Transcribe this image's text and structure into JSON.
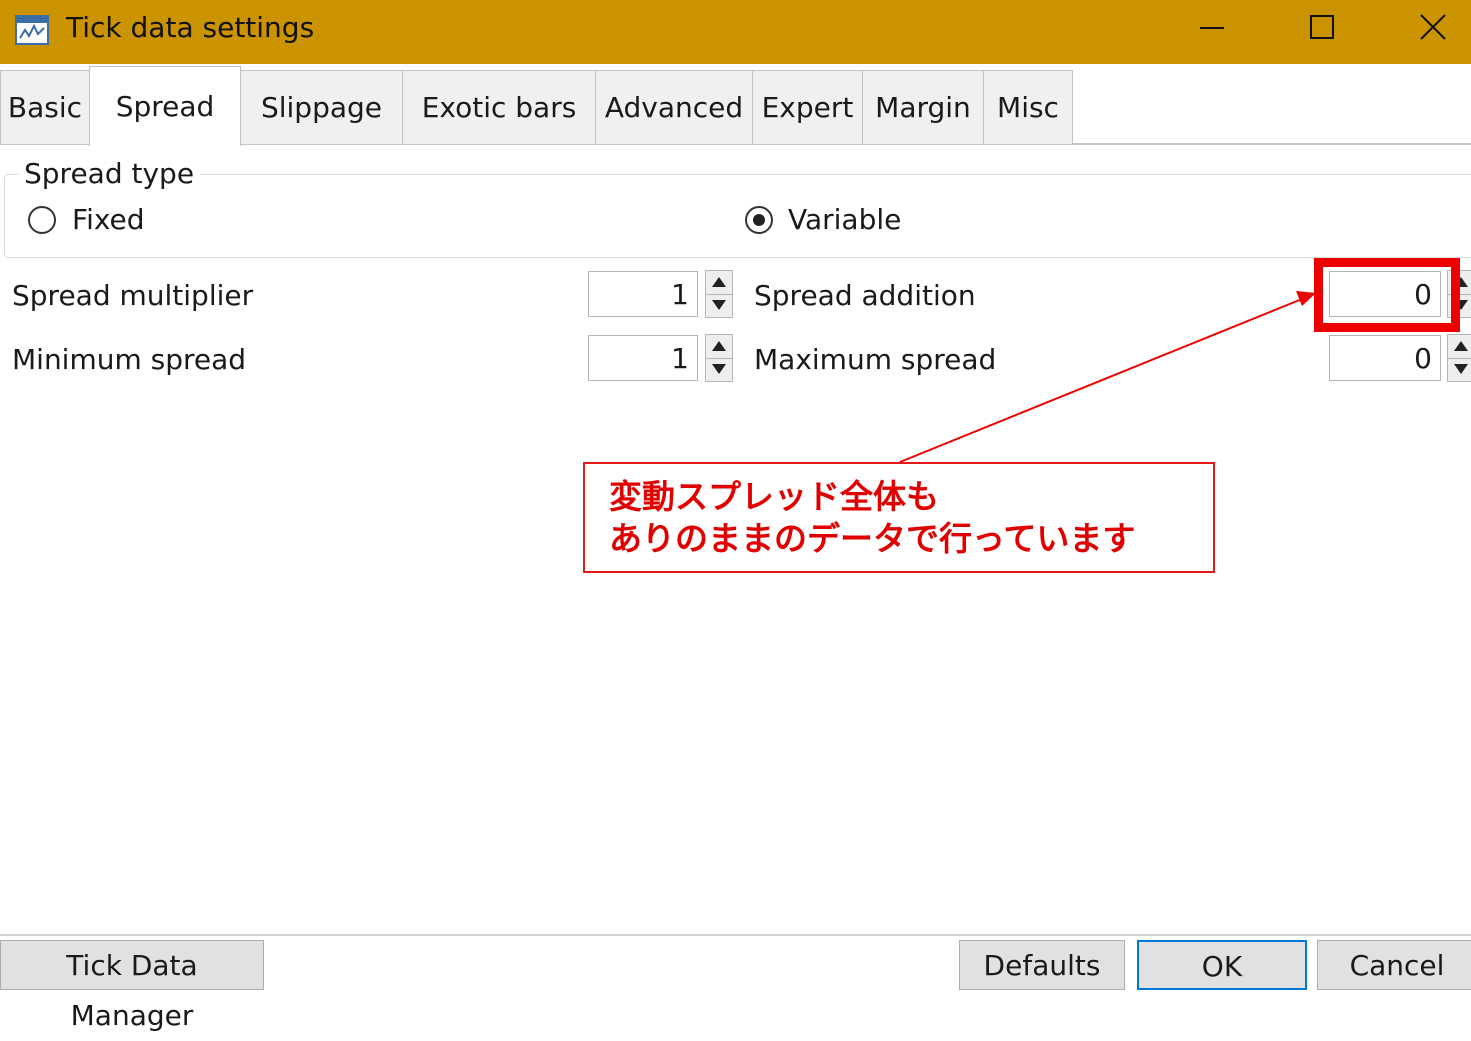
{
  "window": {
    "title": "Tick data settings",
    "title_bar_color": "#cc9300",
    "icon": "app-chart-icon",
    "controls": [
      "minimize-icon",
      "maximize-icon",
      "close-icon"
    ]
  },
  "tabs": [
    {
      "label": "Basic",
      "active": false
    },
    {
      "label": "Spread",
      "active": true
    },
    {
      "label": "Slippage",
      "active": false
    },
    {
      "label": "Exotic bars",
      "active": false
    },
    {
      "label": "Advanced",
      "active": false
    },
    {
      "label": "Expert",
      "active": false
    },
    {
      "label": "Margin",
      "active": false
    },
    {
      "label": "Misc",
      "active": false
    }
  ],
  "spread_type": {
    "group_title": "Spread type",
    "options": [
      {
        "label": "Fixed",
        "selected": false
      },
      {
        "label": "Variable",
        "selected": true
      }
    ]
  },
  "fields": {
    "spread_multiplier": {
      "label": "Spread multiplier",
      "value": "1"
    },
    "minimum_spread": {
      "label": "Minimum spread",
      "value": "1"
    },
    "spread_addition": {
      "label": "Spread addition",
      "value": "0"
    },
    "maximum_spread": {
      "label": "Maximum spread",
      "value": "0"
    }
  },
  "annotation": {
    "line1": "変動スプレッド全体も",
    "line2": "ありのままのデータで行っています",
    "color": "#e00000"
  },
  "buttons": {
    "tick_data_manager": "Tick Data Manager",
    "defaults": "Defaults",
    "ok": "OK",
    "cancel": "Cancel"
  }
}
